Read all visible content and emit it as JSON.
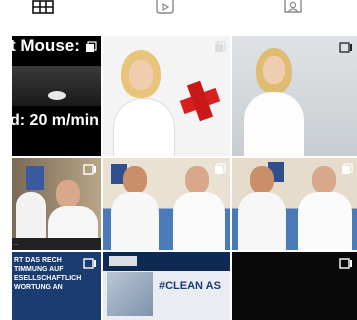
{
  "tabs": [
    {
      "icon": "grid-icon"
    },
    {
      "icon": "reels-icon"
    },
    {
      "icon": "tagged-icon"
    }
  ],
  "posts": [
    {
      "index": 0,
      "type": "multi-image",
      "caption_top": "t Mouse:",
      "caption_bottom": "d: 20 m/min"
    },
    {
      "index": 1,
      "type": "multi-image"
    },
    {
      "index": 2,
      "type": "multi-image"
    },
    {
      "index": 3,
      "type": "multi-image",
      "bottom_strip": "..."
    },
    {
      "index": 4,
      "type": "multi-image"
    },
    {
      "index": 5,
      "type": "multi-image"
    },
    {
      "index": 6,
      "type": "multi-image",
      "lines": [
        "RT DAS RECH",
        "TIMMUNG AUF",
        "ESELLSCHAFTLICH",
        "WORTUNG AN"
      ]
    },
    {
      "index": 7,
      "type": "image",
      "text": "#CLEAN AS"
    },
    {
      "index": 8,
      "type": "multi-image"
    }
  ],
  "colors": {
    "accent_red": "#d92020",
    "court_blue": "#4a7ab8",
    "dark": "#0a0a0a"
  }
}
